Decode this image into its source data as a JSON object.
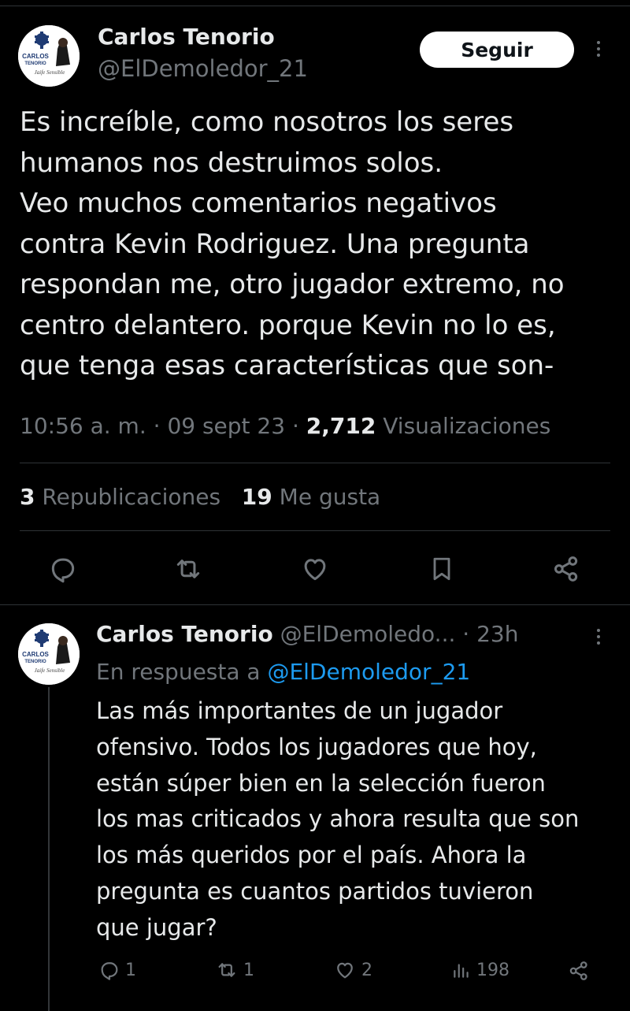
{
  "main_tweet": {
    "author_name": "Carlos Tenorio",
    "author_handle": "@ElDemoledor_21",
    "follow_label": "Seguir",
    "avatar_logo_text": "CARLOS TENORIO",
    "avatar_signature": "Jaife Sensible",
    "text_lines": [
      "Es increíble, como nosotros los seres",
      "humanos nos destruimos solos.",
      "Veo muchos comentarios negativos",
      "contra Kevin Rodriguez. Una pregunta",
      "respondan me, otro jugador extremo, no",
      "centro delantero. porque Kevin no lo es,",
      "que tenga esas características que son-"
    ],
    "time": "10:56 a. m.",
    "date": "09 sept 23",
    "views_count": "2,712",
    "views_label": "Visualizaciones",
    "reposts_count": "3",
    "reposts_label": "Republicaciones",
    "likes_count": "19",
    "likes_label": "Me gusta",
    "actions": [
      "reply-icon",
      "repost-icon",
      "like-icon",
      "bookmark-icon",
      "share-icon"
    ]
  },
  "reply_tweet": {
    "author_name": "Carlos Tenorio",
    "author_handle": "@ElDemoledo...",
    "separator": " · ",
    "age": "23h",
    "in_reply_prefix": "En respuesta a",
    "in_reply_handle": "@ElDemoledor_21",
    "text_lines": [
      "Las más importantes de un jugador",
      "ofensivo. Todos los jugadores que hoy,",
      "están súper bien en la selección fueron",
      "los mas criticados y ahora resulta que son",
      "los más queridos por el país. Ahora la",
      "pregunta es cuantos partidos tuvieron",
      "que jugar?"
    ],
    "reply_count": "1",
    "repost_count": "1",
    "like_count": "2",
    "views_count": "198"
  },
  "colors": {
    "background": "#000000",
    "text_primary": "#e7e9ea",
    "text_secondary": "#71767b",
    "link": "#1d9bf0",
    "divider": "#2f3336"
  }
}
